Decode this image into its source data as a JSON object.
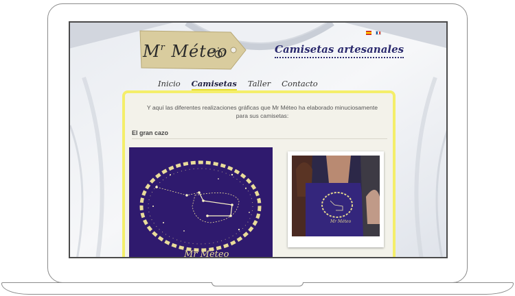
{
  "site": {
    "logo_text": "Mr Météo",
    "logo_main": "Méteo",
    "logo_prefix": "M",
    "logo_sup": "r",
    "tagline": "Camisetas artesanales",
    "languages": [
      "es",
      "fr"
    ]
  },
  "nav": {
    "items": [
      {
        "label": "Inicio"
      },
      {
        "label": "Camisetas"
      },
      {
        "label": "Taller"
      },
      {
        "label": "Contacto"
      }
    ],
    "active": "Camisetas"
  },
  "main": {
    "intro": "Y aquí las diferentes realizaciones gráficas que Mr Méteo ha elaborado minuciosamente para sus camisetas:",
    "section_title": "El gran cazo",
    "design_signature": "Mr Méteo"
  },
  "colors": {
    "accent_yellow": "#f4ee6a",
    "navy": "#2b2a6e",
    "design_bg": "#2f1a6e",
    "design_line": "#e9dc9a"
  }
}
